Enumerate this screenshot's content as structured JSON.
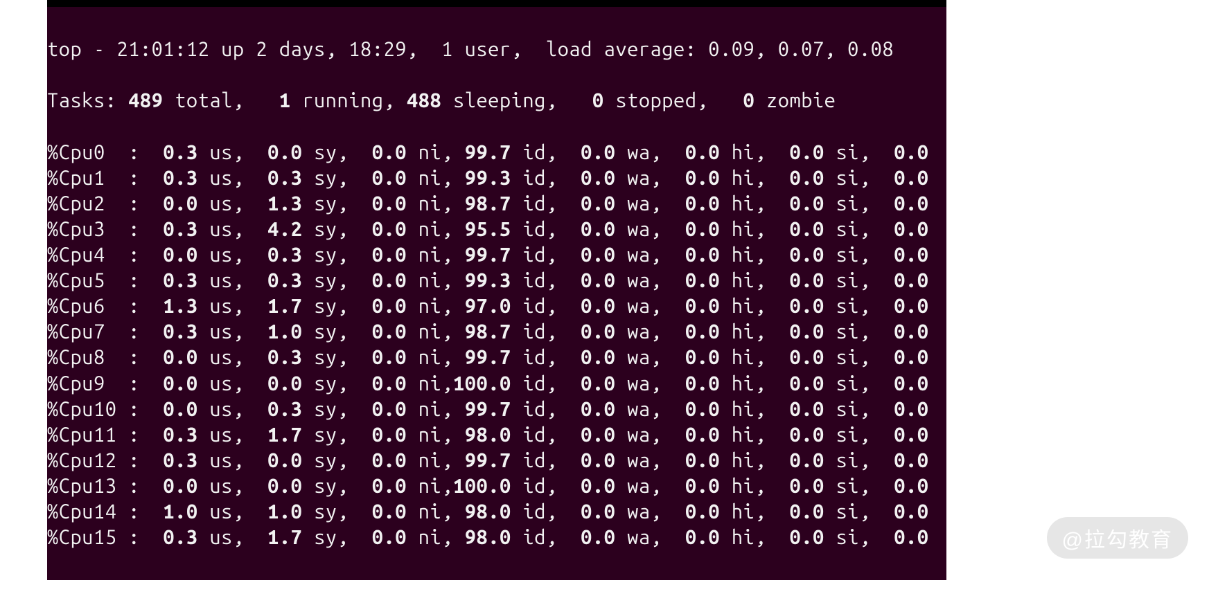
{
  "watermark": "@拉勾教育",
  "header": {
    "prefix": "top - ",
    "time": "21:01:12",
    "up_label": " up ",
    "uptime": "2 days, 18:29",
    "sep1": ",  ",
    "users": "1 user",
    "sep2": ",  ",
    "load_label": "load average: ",
    "load": "0.09, 0.07, 0.08"
  },
  "tasks": {
    "label": "Tasks: ",
    "total_val": "489",
    "total_lbl": " total,   ",
    "running_val": "1",
    "running_lbl": " running, ",
    "sleeping_val": "488",
    "sleeping_lbl": " sleeping,   ",
    "stopped_val": "0",
    "stopped_lbl": " stopped,   ",
    "zombie_val": "0",
    "zombie_lbl": " zombie"
  },
  "cpus": [
    {
      "name": "%Cpu0 ",
      "us": "0.3",
      "sy": "0.0",
      "ni": "0.0",
      "id": "99.7",
      "id_sep": ", ",
      "wa": "0.0",
      "hi": "0.0",
      "si": "0.0",
      "st": "0.0"
    },
    {
      "name": "%Cpu1 ",
      "us": "0.3",
      "sy": "0.3",
      "ni": "0.0",
      "id": "99.3",
      "id_sep": ", ",
      "wa": "0.0",
      "hi": "0.0",
      "si": "0.0",
      "st": "0.0"
    },
    {
      "name": "%Cpu2 ",
      "us": "0.0",
      "sy": "1.3",
      "ni": "0.0",
      "id": "98.7",
      "id_sep": ", ",
      "wa": "0.0",
      "hi": "0.0",
      "si": "0.0",
      "st": "0.0"
    },
    {
      "name": "%Cpu3 ",
      "us": "0.3",
      "sy": "4.2",
      "ni": "0.0",
      "id": "95.5",
      "id_sep": ", ",
      "wa": "0.0",
      "hi": "0.0",
      "si": "0.0",
      "st": "0.0"
    },
    {
      "name": "%Cpu4 ",
      "us": "0.0",
      "sy": "0.3",
      "ni": "0.0",
      "id": "99.7",
      "id_sep": ", ",
      "wa": "0.0",
      "hi": "0.0",
      "si": "0.0",
      "st": "0.0"
    },
    {
      "name": "%Cpu5 ",
      "us": "0.3",
      "sy": "0.3",
      "ni": "0.0",
      "id": "99.3",
      "id_sep": ", ",
      "wa": "0.0",
      "hi": "0.0",
      "si": "0.0",
      "st": "0.0"
    },
    {
      "name": "%Cpu6 ",
      "us": "1.3",
      "sy": "1.7",
      "ni": "0.0",
      "id": "97.0",
      "id_sep": ", ",
      "wa": "0.0",
      "hi": "0.0",
      "si": "0.0",
      "st": "0.0"
    },
    {
      "name": "%Cpu7 ",
      "us": "0.3",
      "sy": "1.0",
      "ni": "0.0",
      "id": "98.7",
      "id_sep": ", ",
      "wa": "0.0",
      "hi": "0.0",
      "si": "0.0",
      "st": "0.0"
    },
    {
      "name": "%Cpu8 ",
      "us": "0.0",
      "sy": "0.3",
      "ni": "0.0",
      "id": "99.7",
      "id_sep": ", ",
      "wa": "0.0",
      "hi": "0.0",
      "si": "0.0",
      "st": "0.0"
    },
    {
      "name": "%Cpu9 ",
      "us": "0.0",
      "sy": "0.0",
      "ni": "0.0",
      "id": "100.0",
      "id_sep": ",",
      "wa": "0.0",
      "hi": "0.0",
      "si": "0.0",
      "st": "0.0"
    },
    {
      "name": "%Cpu10",
      "us": "0.0",
      "sy": "0.3",
      "ni": "0.0",
      "id": "99.7",
      "id_sep": ", ",
      "wa": "0.0",
      "hi": "0.0",
      "si": "0.0",
      "st": "0.0"
    },
    {
      "name": "%Cpu11",
      "us": "0.3",
      "sy": "1.7",
      "ni": "0.0",
      "id": "98.0",
      "id_sep": ", ",
      "wa": "0.0",
      "hi": "0.0",
      "si": "0.0",
      "st": "0.0"
    },
    {
      "name": "%Cpu12",
      "us": "0.3",
      "sy": "0.0",
      "ni": "0.0",
      "id": "99.7",
      "id_sep": ", ",
      "wa": "0.0",
      "hi": "0.0",
      "si": "0.0",
      "st": "0.0"
    },
    {
      "name": "%Cpu13",
      "us": "0.0",
      "sy": "0.0",
      "ni": "0.0",
      "id": "100.0",
      "id_sep": ",",
      "wa": "0.0",
      "hi": "0.0",
      "si": "0.0",
      "st": "0.0"
    },
    {
      "name": "%Cpu14",
      "us": "1.0",
      "sy": "1.0",
      "ni": "0.0",
      "id": "98.0",
      "id_sep": ", ",
      "wa": "0.0",
      "hi": "0.0",
      "si": "0.0",
      "st": "0.0"
    },
    {
      "name": "%Cpu15",
      "us": "0.3",
      "sy": "1.7",
      "ni": "0.0",
      "id": "98.0",
      "id_sep": ", ",
      "wa": "0.0",
      "hi": "0.0",
      "si": "0.0",
      "st": "0.0"
    }
  ],
  "labels": {
    "us": " us,  ",
    "sy": " sy,  ",
    "ni": " ni",
    "id": " id,  ",
    "wa": " wa,  ",
    "hi": " hi,  ",
    "si": " si,  "
  }
}
